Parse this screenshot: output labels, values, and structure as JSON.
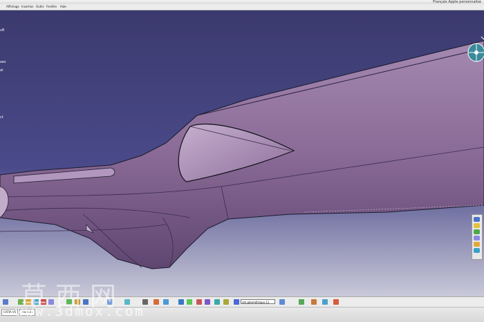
{
  "window": {
    "title_right": "Français Apple personnalisé"
  },
  "menubar": {
    "items": [
      "Affichage",
      "Insertion",
      "Outils",
      "Fenêtre",
      "Aide"
    ]
  },
  "tree": {
    "labels": [
      "v8",
      "xes",
      "al",
      "ct"
    ]
  },
  "toolbar": {
    "select_value": "set géométrique.11"
  },
  "taskbar": {
    "buttons": [
      "CATIA V5",
      "Français"
    ]
  },
  "watermark": {
    "text": "草西网",
    "url": "www.3dmox.com"
  },
  "colors": {
    "background_top": "#3b3a6e",
    "part_fill": "#8a6a96",
    "edges": "#1a1a2a"
  }
}
